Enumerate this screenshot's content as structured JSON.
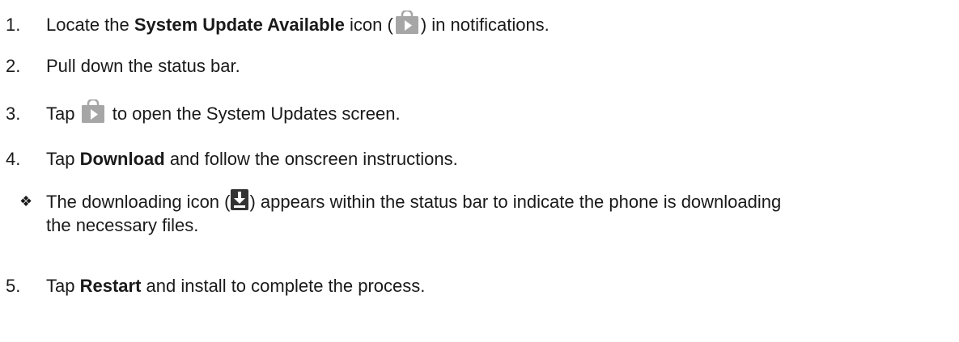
{
  "steps": [
    {
      "number": "1.",
      "pre": "Locate the ",
      "bold": "System Update Available",
      "post_a": " icon (",
      "post_b": ") in notifications."
    },
    {
      "number": "2.",
      "text": "Pull down the status bar."
    },
    {
      "number": "3.",
      "pre": "Tap ",
      "post": " to open the System Updates screen."
    },
    {
      "number": "4.",
      "pre": "Tap ",
      "bold": "Download",
      "post": " and follow the onscreen instructions."
    },
    {
      "number": "5.",
      "pre": "Tap ",
      "bold": "Restart",
      "post": " and install to complete the process."
    }
  ],
  "note": {
    "bullet": "❖",
    "line1_pre": "The downloading icon (",
    "line1_post": ") appears within the status bar to indicate the phone is downloading",
    "line2": "the necessary files."
  },
  "icons": {
    "update_icon": "shopping-bag-play-icon",
    "download_icon": "download-arrow-icon",
    "icon_color": "#a6a6a6",
    "download_icon_color": "#333333"
  }
}
